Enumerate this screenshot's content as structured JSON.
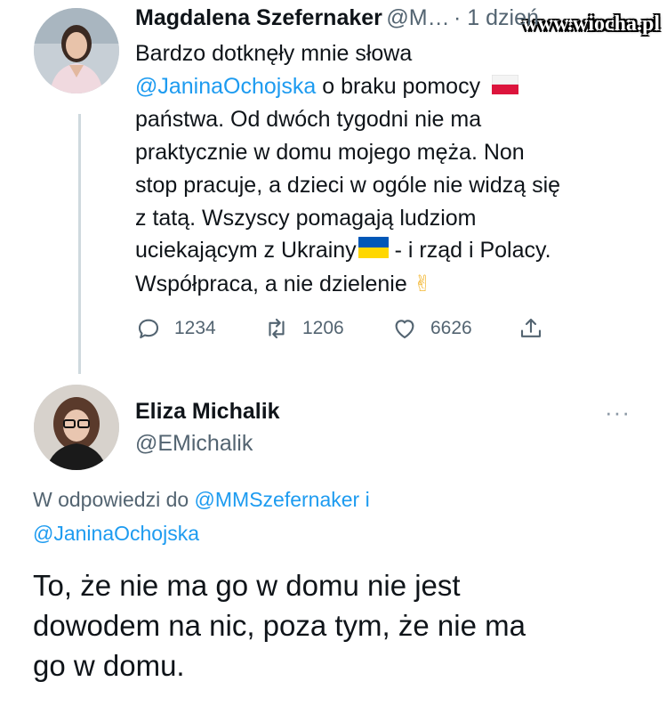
{
  "watermark": "www.wiocha.pl",
  "tweet1": {
    "author_name": "Magdalena Szefernaker",
    "author_handle": "@M…",
    "time": "· 1 dzień",
    "text_1": "Bardzo dotknęły mnie słowa",
    "mention": "@JaninaOchojska",
    "text_2": "o braku pomocy",
    "text_3": "państwa. Od dwóch tygodni nie ma",
    "text_4": "praktycznie w domu mojego męża. Non",
    "text_5": "stop pracuje, a dzieci w ogóle nie widzą się",
    "text_6": "z tatą. Wszyscy pomagają ludziom",
    "text_7": "uciekającym z Ukrainy",
    "text_8": " - i rząd i Polacy.",
    "text_9": "Współpraca, a nie dzielenie",
    "emoji_victory": "✌",
    "flag_pl_colors": [
      "#ffffff",
      "#dc143c"
    ],
    "flag_ua_colors": [
      "#0057b7",
      "#ffd700"
    ],
    "reply_count": "1234",
    "retweet_count": "1206",
    "like_count": "6626"
  },
  "tweet2": {
    "author_name": "Eliza Michalik",
    "author_handle": "@EMichalik",
    "more_icon": "···",
    "reply_prefix": "W odpowiedzi do",
    "reply_to_1": "@MMSzefernaker",
    "reply_and": "i",
    "reply_to_2": "@JaninaOchojska",
    "text_1": "To, że nie ma go w domu nie jest",
    "text_2": "dowodem na nic, poza tym, że nie ma",
    "text_3": "go w domu."
  },
  "colors": {
    "accent": "#1d9bf0",
    "secondary_text": "#536471",
    "thread_line": "#cfd9de"
  }
}
